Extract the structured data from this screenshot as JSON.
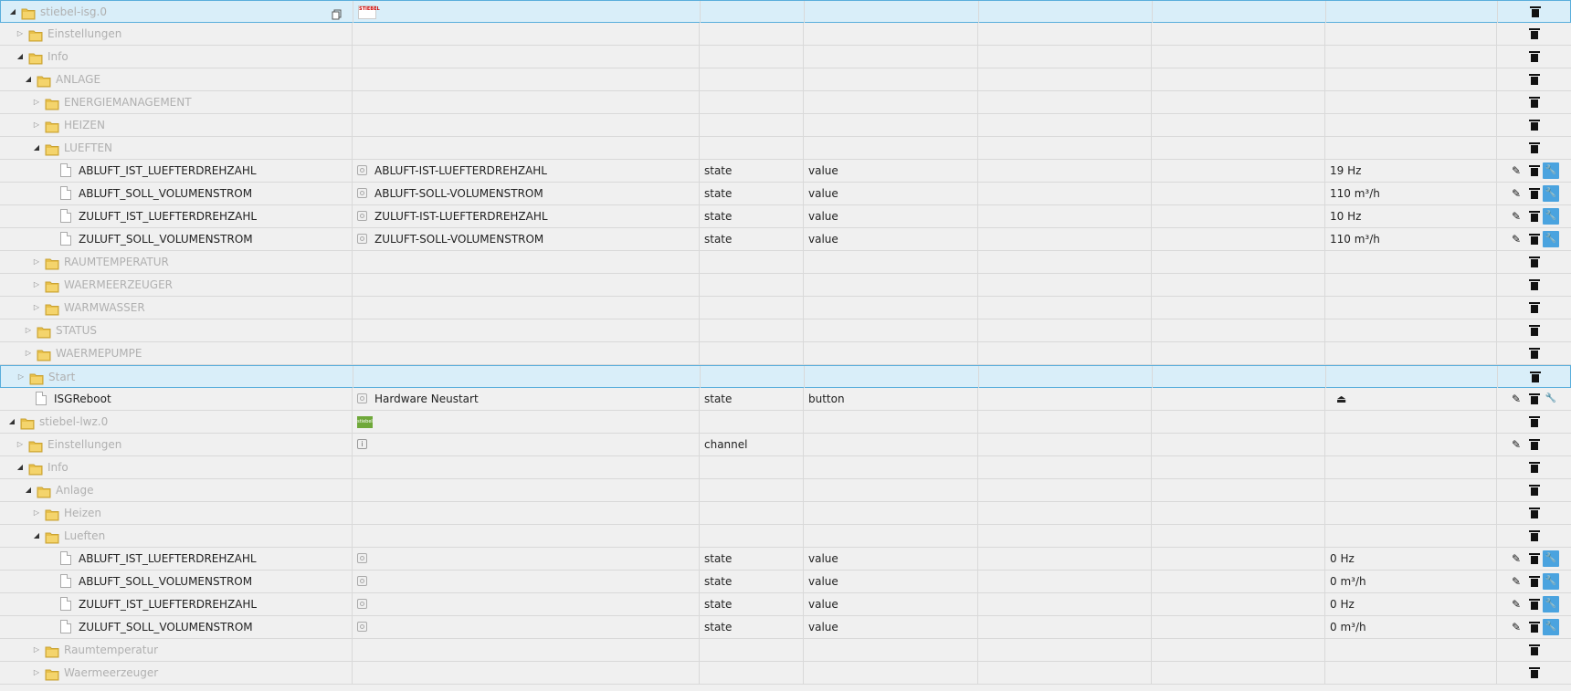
{
  "rows": [
    {
      "indent": 0,
      "expand": "open",
      "icon": "folder",
      "id": "stiebel-isg.0",
      "style": "muted",
      "logo": "stiebel",
      "logo_text": "STIEBEL",
      "copy": true,
      "selected": true,
      "actions": [
        "delete"
      ]
    },
    {
      "indent": 1,
      "expand": "closed",
      "icon": "folder",
      "id": "Einstellungen",
      "style": "muted",
      "actions": [
        "delete"
      ]
    },
    {
      "indent": 1,
      "expand": "open",
      "icon": "folder",
      "id": "Info",
      "style": "muted",
      "actions": [
        "delete"
      ]
    },
    {
      "indent": 2,
      "expand": "open",
      "icon": "folder",
      "id": "ANLAGE",
      "style": "muted",
      "actions": [
        "delete"
      ]
    },
    {
      "indent": 3,
      "expand": "closed",
      "icon": "folder",
      "id": "ENERGIEMANAGEMENT",
      "style": "muted",
      "actions": [
        "delete"
      ]
    },
    {
      "indent": 3,
      "expand": "closed",
      "icon": "folder",
      "id": "HEIZEN",
      "style": "muted",
      "actions": [
        "delete"
      ]
    },
    {
      "indent": 3,
      "expand": "open",
      "icon": "folder",
      "id": "LUEFTEN",
      "style": "muted",
      "actions": [
        "delete"
      ]
    },
    {
      "indent": 4,
      "icon": "file",
      "id": "ABLUFT_IST_LUEFTERDREHZAHL",
      "style": "dark",
      "name": "ABLUFT-IST-LUEFTERDREHZAHL",
      "type": "state",
      "role": "value",
      "val": "19 Hz",
      "actions": [
        "edit",
        "delete",
        "wrench"
      ]
    },
    {
      "indent": 4,
      "icon": "file",
      "id": "ABLUFT_SOLL_VOLUMENSTROM",
      "style": "dark",
      "name": "ABLUFT-SOLL-VOLUMENSTROM",
      "type": "state",
      "role": "value",
      "val": "110 m³/h",
      "actions": [
        "edit",
        "delete",
        "wrench"
      ]
    },
    {
      "indent": 4,
      "icon": "file",
      "id": "ZULUFT_IST_LUEFTERDREHZAHL",
      "style": "dark",
      "name": "ZULUFT-IST-LUEFTERDREHZAHL",
      "type": "state",
      "role": "value",
      "val": "10 Hz",
      "actions": [
        "edit",
        "delete",
        "wrench"
      ]
    },
    {
      "indent": 4,
      "icon": "file",
      "id": "ZULUFT_SOLL_VOLUMENSTROM",
      "style": "dark",
      "name": "ZULUFT-SOLL-VOLUMENSTROM",
      "type": "state",
      "role": "value",
      "val": "110 m³/h",
      "actions": [
        "edit",
        "delete",
        "wrench"
      ]
    },
    {
      "indent": 3,
      "expand": "closed",
      "icon": "folder",
      "id": "RAUMTEMPERATUR",
      "style": "muted",
      "actions": [
        "delete"
      ]
    },
    {
      "indent": 3,
      "expand": "closed",
      "icon": "folder",
      "id": "WAERMEERZEUGER",
      "style": "muted",
      "actions": [
        "delete"
      ]
    },
    {
      "indent": 3,
      "expand": "closed",
      "icon": "folder",
      "id": "WARMWASSER",
      "style": "muted",
      "actions": [
        "delete"
      ]
    },
    {
      "indent": 2,
      "expand": "closed",
      "icon": "folder",
      "id": "STATUS",
      "style": "muted",
      "actions": [
        "delete"
      ]
    },
    {
      "indent": 2,
      "expand": "closed",
      "icon": "folder",
      "id": "WAERMEPUMPE",
      "style": "muted",
      "actions": [
        "delete"
      ]
    },
    {
      "indent": 1,
      "expand": "closed",
      "icon": "folder",
      "id": "Start",
      "style": "muted",
      "selected": true,
      "actions": [
        "delete"
      ]
    },
    {
      "indent": 1,
      "icon": "file",
      "id": "ISGReboot",
      "style": "dark",
      "name": "Hardware Neustart",
      "type": "state",
      "role": "button",
      "val": "⏏",
      "actions": [
        "edit",
        "delete",
        "wrench-plain"
      ]
    },
    {
      "indent": 0,
      "expand": "open",
      "icon": "folder",
      "id": "stiebel-lwz.0",
      "style": "muted",
      "logo": "lwz",
      "logo_text": "stiebel",
      "actions": [
        "delete"
      ]
    },
    {
      "indent": 1,
      "expand": "closed",
      "icon": "folder",
      "id": "Einstellungen",
      "style": "muted",
      "name_info": true,
      "type": "channel",
      "actions": [
        "edit",
        "delete"
      ]
    },
    {
      "indent": 1,
      "expand": "open",
      "icon": "folder",
      "id": "Info",
      "style": "muted",
      "actions": [
        "delete"
      ]
    },
    {
      "indent": 2,
      "expand": "open",
      "icon": "folder",
      "id": "Anlage",
      "style": "muted",
      "actions": [
        "delete"
      ]
    },
    {
      "indent": 3,
      "expand": "closed",
      "icon": "folder",
      "id": "Heizen",
      "style": "muted",
      "actions": [
        "delete"
      ]
    },
    {
      "indent": 3,
      "expand": "open",
      "icon": "folder",
      "id": "Lueften",
      "style": "muted",
      "actions": [
        "delete"
      ]
    },
    {
      "indent": 4,
      "icon": "file",
      "id": "ABLUFT_IST_LUEFTERDREHZAHL",
      "style": "dark",
      "name": "",
      "name_icon": true,
      "type": "state",
      "role": "value",
      "val": "0 Hz",
      "actions": [
        "edit",
        "delete",
        "wrench"
      ]
    },
    {
      "indent": 4,
      "icon": "file",
      "id": "ABLUFT_SOLL_VOLUMENSTROM",
      "style": "dark",
      "name": "",
      "name_icon": true,
      "type": "state",
      "role": "value",
      "val": "0 m³/h",
      "actions": [
        "edit",
        "delete",
        "wrench"
      ]
    },
    {
      "indent": 4,
      "icon": "file",
      "id": "ZULUFT_IST_LUEFTERDREHZAHL",
      "style": "dark",
      "name": "",
      "name_icon": true,
      "type": "state",
      "role": "value",
      "val": "0 Hz",
      "actions": [
        "edit",
        "delete",
        "wrench"
      ]
    },
    {
      "indent": 4,
      "icon": "file",
      "id": "ZULUFT_SOLL_VOLUMENSTROM",
      "style": "dark",
      "name": "",
      "name_icon": true,
      "type": "state",
      "role": "value",
      "val": "0 m³/h",
      "actions": [
        "edit",
        "delete",
        "wrench"
      ]
    },
    {
      "indent": 3,
      "expand": "closed",
      "icon": "folder",
      "id": "Raumtemperatur",
      "style": "muted",
      "actions": [
        "delete"
      ]
    },
    {
      "indent": 3,
      "expand": "closed",
      "icon": "folder",
      "id": "Waermeerzeuger",
      "style": "muted",
      "actions": [
        "delete"
      ]
    }
  ]
}
